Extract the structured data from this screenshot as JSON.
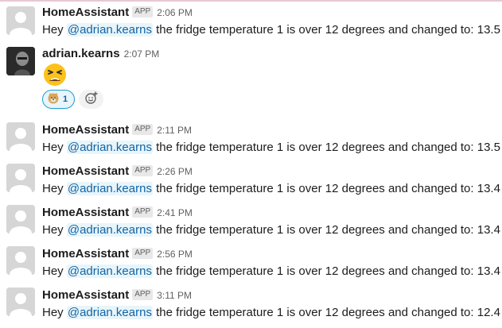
{
  "messages": [
    {
      "sender": "HomeAssistant",
      "badge": "APP",
      "time": "2:06 PM",
      "pre": "Hey ",
      "mention": "@adrian.kearns",
      "post": " the fridge temperature 1 is over 12 degrees and changed to: 13.5"
    },
    {
      "sender": "adrian.kearns",
      "time": "2:07 PM",
      "emoji": "tired-face-emoji",
      "reaction": {
        "emoji": "doge-emoji",
        "count": "1"
      }
    },
    {
      "sender": "HomeAssistant",
      "badge": "APP",
      "time": "2:11 PM",
      "pre": "Hey ",
      "mention": "@adrian.kearns",
      "post": " the fridge temperature 1 is over 12 degrees and changed to: 13.5"
    },
    {
      "sender": "HomeAssistant",
      "badge": "APP",
      "time": "2:26 PM",
      "pre": "Hey ",
      "mention": "@adrian.kearns",
      "post": " the fridge temperature 1 is over 12 degrees and changed to: 13.4"
    },
    {
      "sender": "HomeAssistant",
      "badge": "APP",
      "time": "2:41 PM",
      "pre": "Hey ",
      "mention": "@adrian.kearns",
      "post": " the fridge temperature 1 is over 12 degrees and changed to: 13.4"
    },
    {
      "sender": "HomeAssistant",
      "badge": "APP",
      "time": "2:56 PM",
      "pre": "Hey ",
      "mention": "@adrian.kearns",
      "post": " the fridge temperature 1 is over 12 degrees and changed to: 13.4"
    },
    {
      "sender": "HomeAssistant",
      "badge": "APP",
      "time": "3:11 PM",
      "pre": "Hey ",
      "mention": "@adrian.kearns",
      "post": " the fridge temperature 1 is over 12 degrees and changed to: 12.4"
    }
  ],
  "colors": {
    "mention_text": "#1264a3",
    "mention_bg": "#e8f5fa",
    "reaction_border": "#1d9bd1"
  }
}
